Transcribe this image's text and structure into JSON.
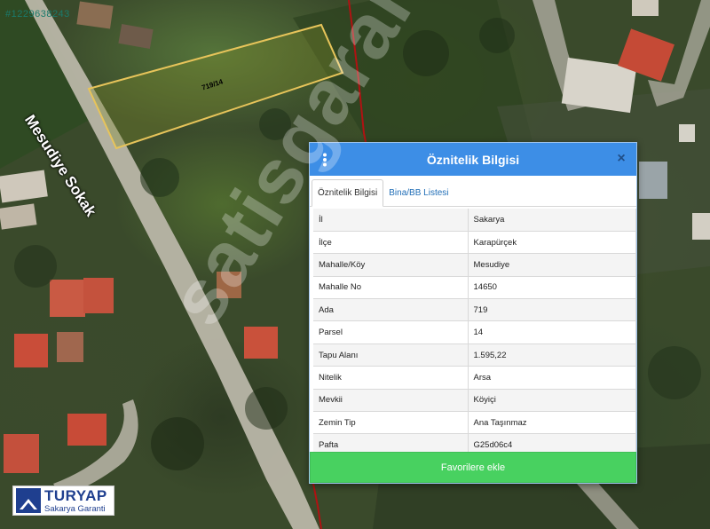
{
  "map": {
    "coord_stamp": "#1229638243",
    "street_label": "Mesudiye Sokak",
    "parcel_label": "719/14",
    "watermark": "satisgaranti.com"
  },
  "logo": {
    "brand": "TURYAP",
    "subtitle": "Sakarya Garanti"
  },
  "panel": {
    "title": "Öznitelik Bilgisi",
    "menu_icon": "vertical-dots-icon",
    "close_label": "×",
    "tabs": [
      {
        "label": "Öznitelik Bilgisi",
        "active": true
      },
      {
        "label": "Bina/BB Listesi",
        "active": false
      }
    ],
    "rows": [
      {
        "key": "İl",
        "value": "Sakarya"
      },
      {
        "key": "İlçe",
        "value": "Karapürçek"
      },
      {
        "key": "Mahalle/Köy",
        "value": "Mesudiye"
      },
      {
        "key": "Mahalle No",
        "value": "14650"
      },
      {
        "key": "Ada",
        "value": "719"
      },
      {
        "key": "Parsel",
        "value": "14"
      },
      {
        "key": "Tapu Alanı",
        "value": "1.595,22"
      },
      {
        "key": "Nitelik",
        "value": "Arsa"
      },
      {
        "key": "Mevkii",
        "value": "Köyiçi"
      },
      {
        "key": "Zemin Tip",
        "value": "Ana Taşınmaz"
      },
      {
        "key": "Pafta",
        "value": "G25d06c4"
      }
    ],
    "favorite_label": "Favorilere ekle"
  },
  "colors": {
    "header_blue": "#3d8ee6",
    "button_green": "#48d160",
    "parcel_outline": "#e7c45a",
    "boundary_red": "#b01212",
    "tab_link_blue": "#1f6db6"
  }
}
